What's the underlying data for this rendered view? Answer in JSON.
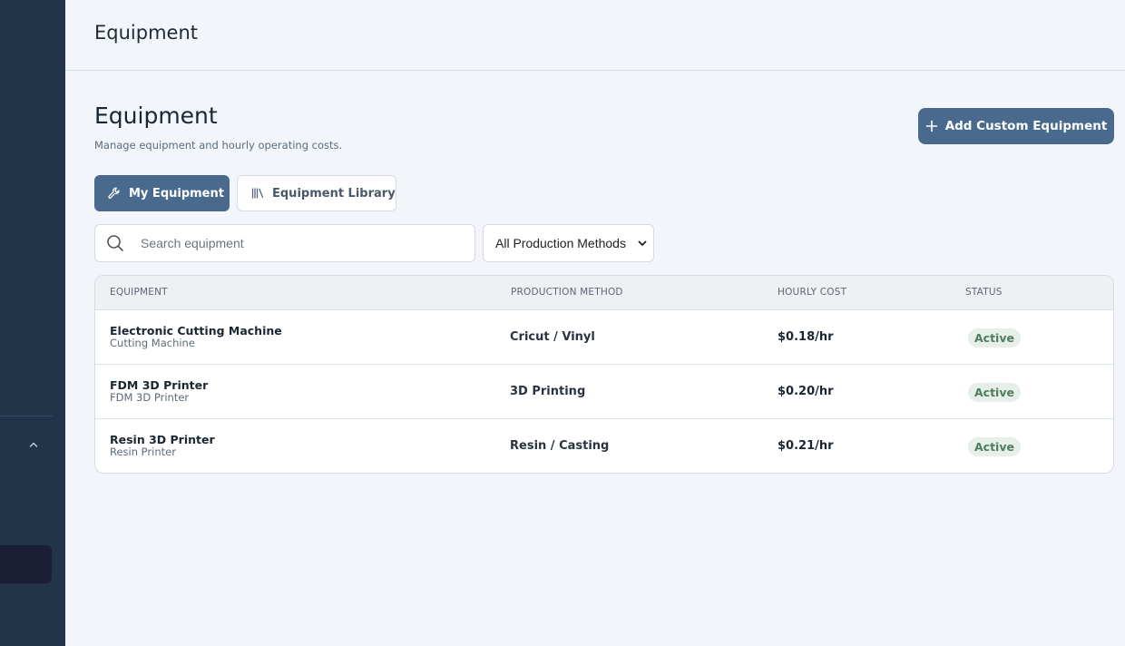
{
  "header": {
    "title": "Equipment"
  },
  "page": {
    "title": "Equipment",
    "subtitle": "Manage equipment and hourly operating costs.",
    "add_button_label": "Add Custom Equipment"
  },
  "tabs": [
    {
      "label": "My Equipment",
      "icon": "wrench-icon",
      "active": true
    },
    {
      "label": "Equipment Library",
      "icon": "library-icon",
      "active": false
    }
  ],
  "search": {
    "placeholder": "Search equipment",
    "value": ""
  },
  "filter": {
    "selected": "All Production Methods"
  },
  "table": {
    "columns": [
      "EQUIPMENT",
      "PRODUCTION METHOD",
      "HOURLY COST",
      "STATUS"
    ],
    "rows": [
      {
        "name": "Electronic Cutting Machine",
        "type": "Cutting Machine",
        "method": "Cricut / Vinyl",
        "cost": "$0.18/hr",
        "status": "Active"
      },
      {
        "name": "FDM 3D Printer",
        "type": "FDM 3D Printer",
        "method": "3D Printing",
        "cost": "$0.20/hr",
        "status": "Active"
      },
      {
        "name": "Resin 3D Printer",
        "type": "Resin Printer",
        "method": "Resin / Casting",
        "cost": "$0.21/hr",
        "status": "Active"
      }
    ]
  },
  "colors": {
    "sidebar": "#21344a",
    "accent": "#4a6a8d",
    "status_active_bg": "#e7efe9",
    "status_active_text": "#4e7c5f"
  }
}
